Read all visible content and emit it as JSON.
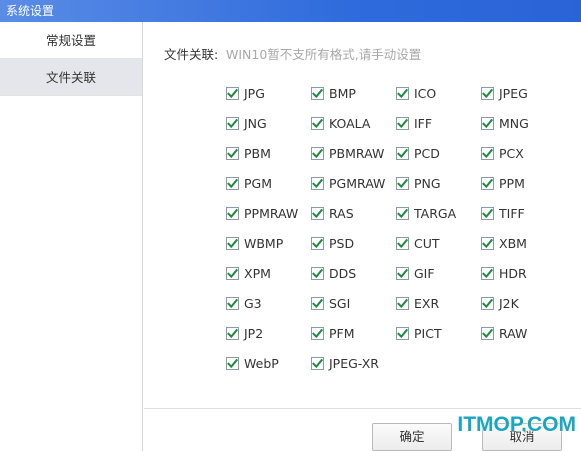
{
  "window": {
    "title": "系统设置"
  },
  "sidebar": {
    "items": [
      {
        "label": "常规设置",
        "active": false
      },
      {
        "label": "文件关联",
        "active": true
      }
    ]
  },
  "association": {
    "label": "文件关联:",
    "hint": "WIN10暂不支所有格式,请手动设置",
    "formats": [
      {
        "label": "JPG",
        "checked": true
      },
      {
        "label": "BMP",
        "checked": true
      },
      {
        "label": "ICO",
        "checked": true
      },
      {
        "label": "JPEG",
        "checked": true
      },
      {
        "label": "JNG",
        "checked": true
      },
      {
        "label": "KOALA",
        "checked": true
      },
      {
        "label": "IFF",
        "checked": true
      },
      {
        "label": "MNG",
        "checked": true
      },
      {
        "label": "PBM",
        "checked": true
      },
      {
        "label": "PBMRAW",
        "checked": true
      },
      {
        "label": "PCD",
        "checked": true
      },
      {
        "label": "PCX",
        "checked": true
      },
      {
        "label": "PGM",
        "checked": true
      },
      {
        "label": "PGMRAW",
        "checked": true
      },
      {
        "label": "PNG",
        "checked": true
      },
      {
        "label": "PPM",
        "checked": true
      },
      {
        "label": "PPMRAW",
        "checked": true
      },
      {
        "label": "RAS",
        "checked": true
      },
      {
        "label": "TARGA",
        "checked": true
      },
      {
        "label": "TIFF",
        "checked": true
      },
      {
        "label": "WBMP",
        "checked": true
      },
      {
        "label": "PSD",
        "checked": true
      },
      {
        "label": "CUT",
        "checked": true
      },
      {
        "label": "XBM",
        "checked": true
      },
      {
        "label": "XPM",
        "checked": true
      },
      {
        "label": "DDS",
        "checked": true
      },
      {
        "label": "GIF",
        "checked": true
      },
      {
        "label": "HDR",
        "checked": true
      },
      {
        "label": "G3",
        "checked": true
      },
      {
        "label": "SGI",
        "checked": true
      },
      {
        "label": "EXR",
        "checked": true
      },
      {
        "label": "J2K",
        "checked": true
      },
      {
        "label": "JP2",
        "checked": true
      },
      {
        "label": "PFM",
        "checked": true
      },
      {
        "label": "PICT",
        "checked": true
      },
      {
        "label": "RAW",
        "checked": true
      },
      {
        "label": "WebP",
        "checked": true
      },
      {
        "label": "JPEG-XR",
        "checked": true
      }
    ]
  },
  "footer": {
    "ok_label": "确定",
    "cancel_label": "取消"
  },
  "watermark": {
    "text": "ITMOP.COM"
  },
  "colors": {
    "titlebar": "#2f6bdc",
    "checkmark": "#1f8a3e",
    "sidebar_active": "#e4e6eb",
    "hint_text": "#a8a8a8",
    "watermark": "#1aa6c2"
  },
  "icons": {
    "checkbox_checked": "checkmark-icon"
  }
}
